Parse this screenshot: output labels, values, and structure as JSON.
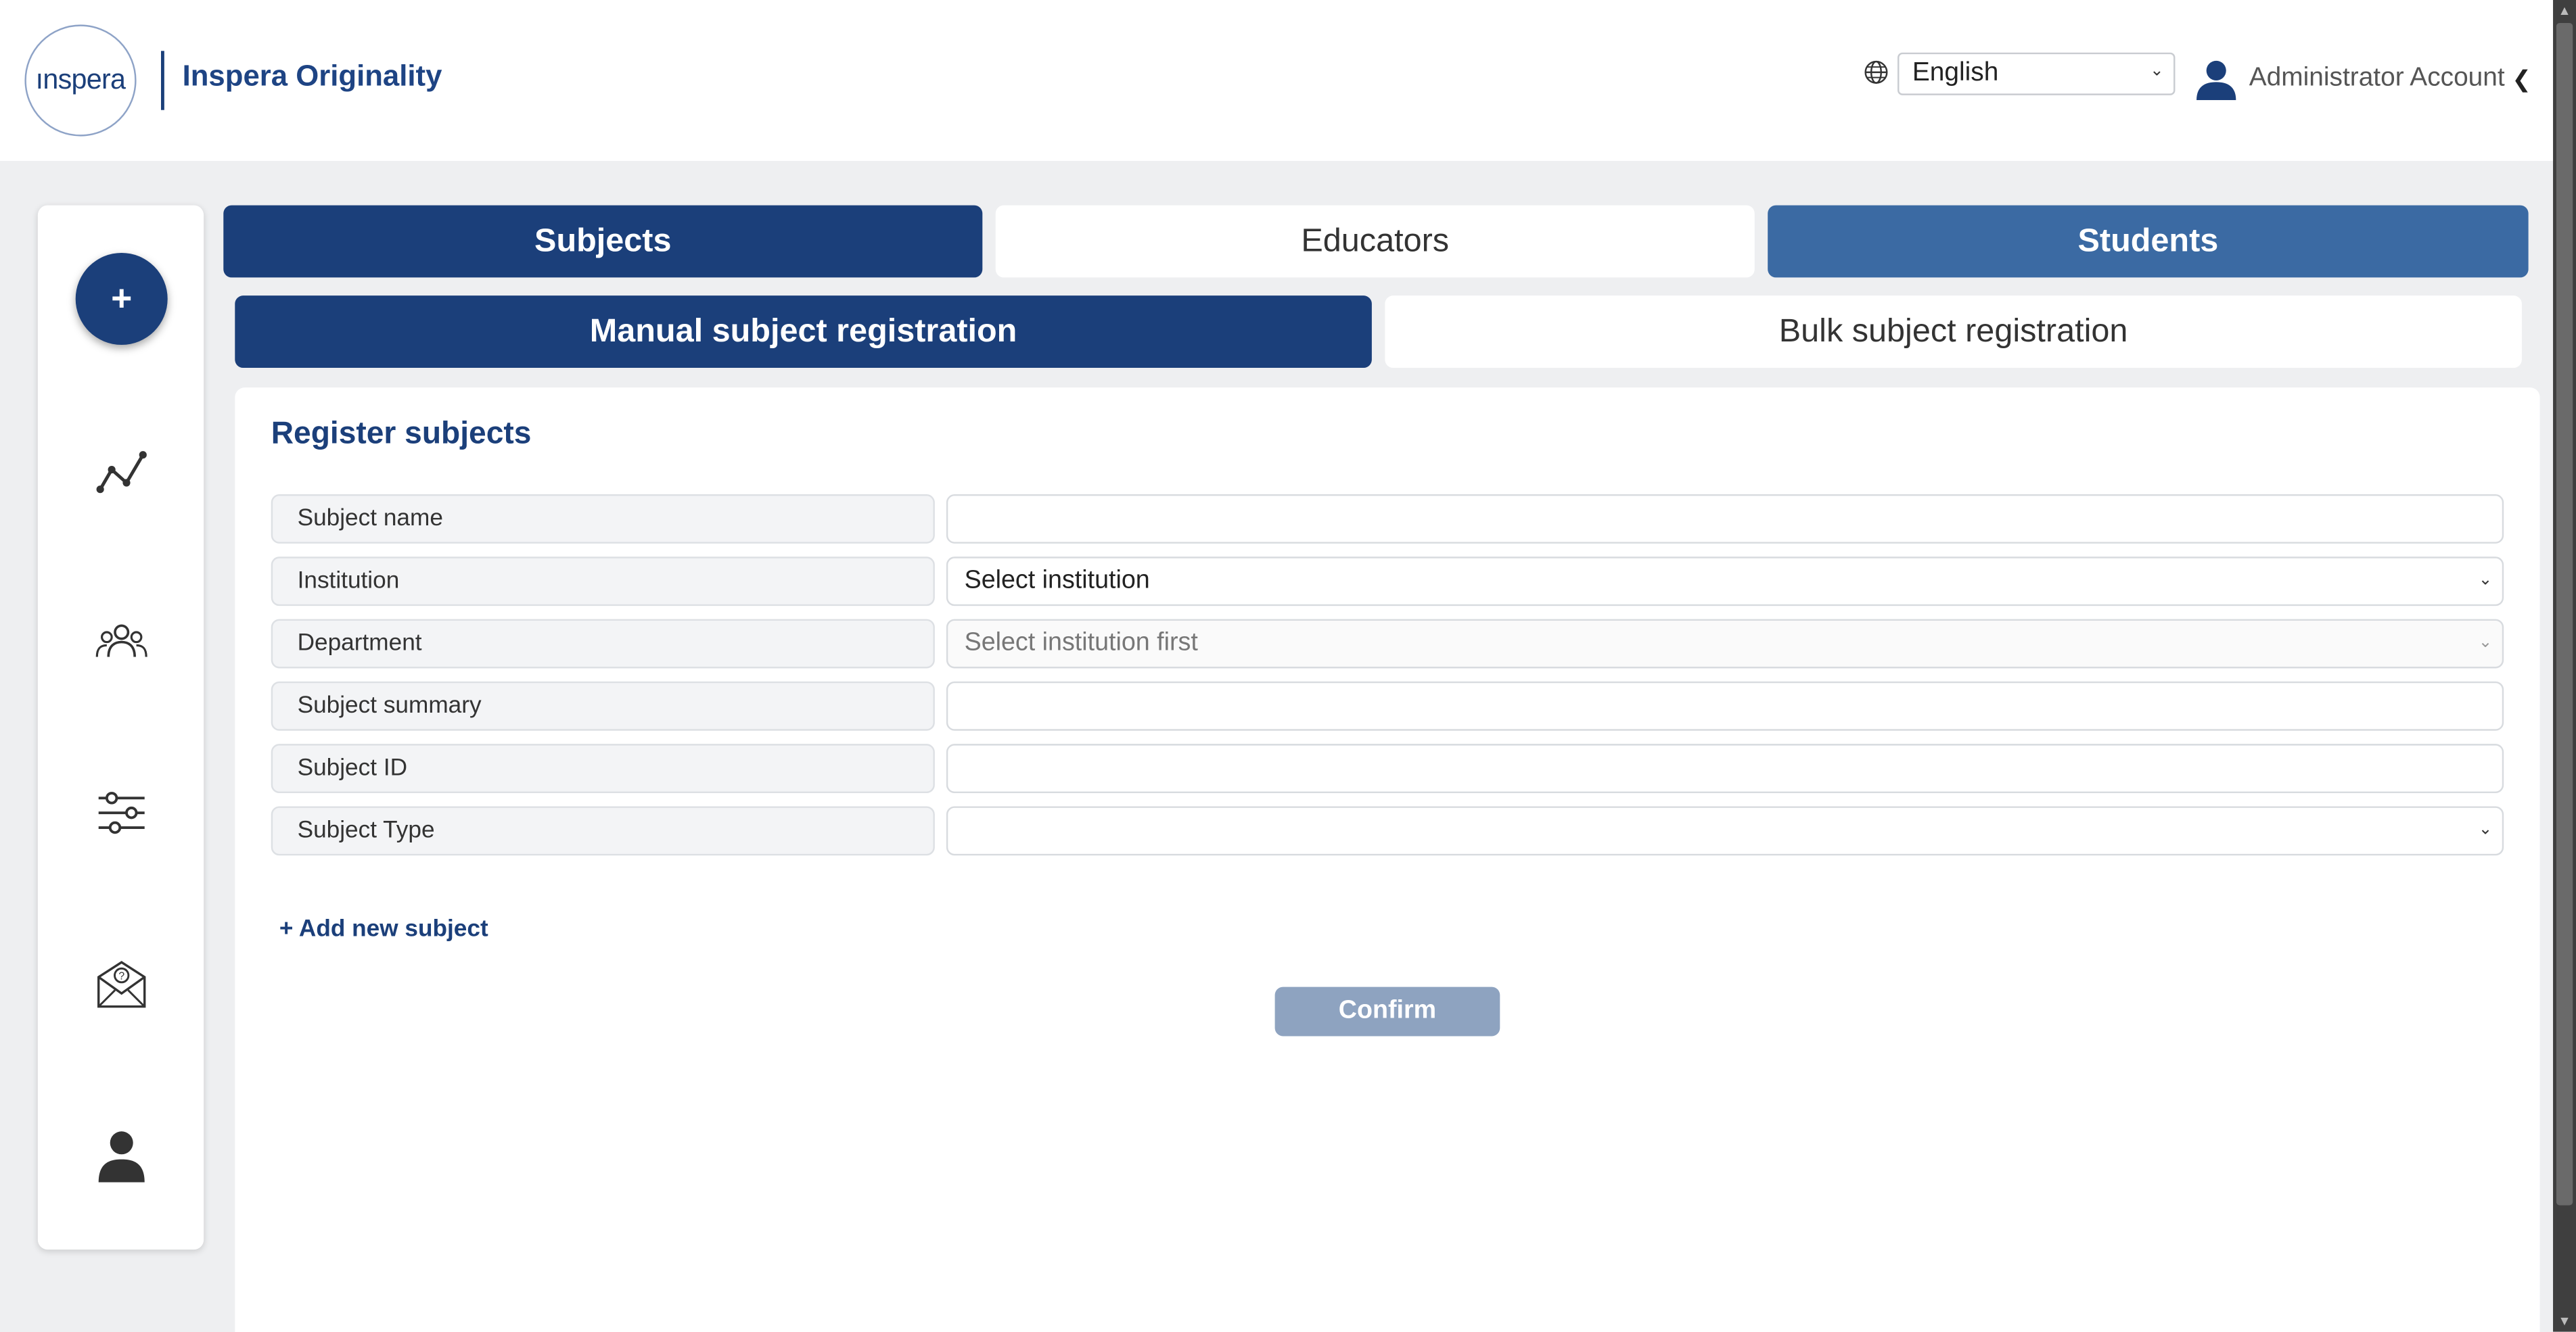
{
  "header": {
    "logo_text": "ınspera",
    "brand": "Inspera Originality",
    "language": {
      "selected": "English"
    },
    "account_name": "Administrator Account"
  },
  "tabs": [
    {
      "label": "Subjects",
      "state": "active"
    },
    {
      "label": "Educators",
      "state": "inactive"
    },
    {
      "label": "Students",
      "state": "secondary"
    }
  ],
  "subtabs": [
    {
      "label": "Manual subject registration",
      "state": "active"
    },
    {
      "label": "Bulk subject registration",
      "state": "inactive"
    }
  ],
  "form": {
    "title": "Register subjects",
    "fields": [
      {
        "label": "Subject name",
        "type": "text",
        "value": ""
      },
      {
        "label": "Institution",
        "type": "select",
        "value": "Select institution"
      },
      {
        "label": "Department",
        "type": "select",
        "value": "Select institution first",
        "disabled": true
      },
      {
        "label": "Subject summary",
        "type": "text",
        "value": ""
      },
      {
        "label": "Subject ID",
        "type": "text",
        "value": ""
      },
      {
        "label": "Subject Type",
        "type": "select",
        "value": ""
      }
    ],
    "add_label": "+ Add new subject",
    "confirm_label": "Confirm"
  },
  "sidebar": {
    "fab_label": "+",
    "icons": [
      "analytics-icon",
      "users-group-icon",
      "settings-sliders-icon",
      "help-mail-icon",
      "profile-icon"
    ]
  },
  "colors": {
    "primary": "#1b3f7a",
    "secondary": "#3b6aa3",
    "confirm_disabled": "#8ea3c0",
    "background": "#eeeff1"
  }
}
